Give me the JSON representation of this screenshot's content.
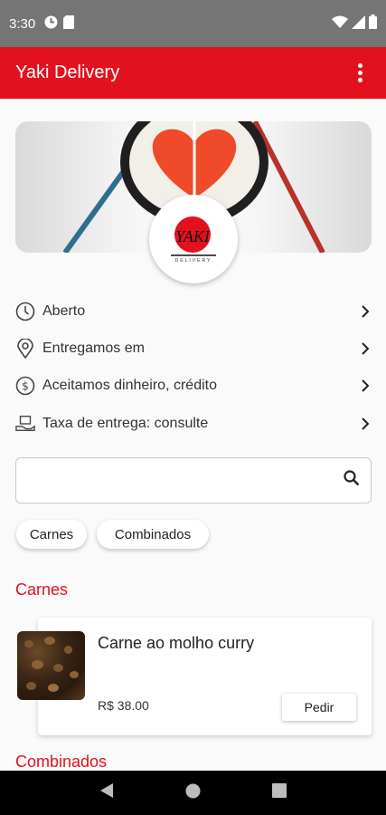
{
  "status_bar": {
    "time": "3:30"
  },
  "app_bar": {
    "title": "Yaki Delivery"
  },
  "store": {
    "logo_text": "YAKI",
    "logo_subtext": "DELIVERY"
  },
  "info": [
    {
      "icon": "clock-icon",
      "label": "Aberto"
    },
    {
      "icon": "location-pin-icon",
      "label": "Entregamos em"
    },
    {
      "icon": "dollar-icon",
      "label": "Aceitamos dinheiro, crédito"
    },
    {
      "icon": "delivery-hand-icon",
      "label": "Taxa de entrega: consulte"
    }
  ],
  "search": {
    "value": "",
    "placeholder": ""
  },
  "chips": [
    "Carnes",
    "Combinados"
  ],
  "sections": [
    {
      "title": "Carnes",
      "products": [
        {
          "name": "Carne ao molho curry",
          "price": "R$ 38.00",
          "button": "Pedir"
        }
      ]
    },
    {
      "title": "Combinados",
      "products": []
    }
  ],
  "colors": {
    "primary": "#e3101e",
    "status_bar": "#757575"
  }
}
